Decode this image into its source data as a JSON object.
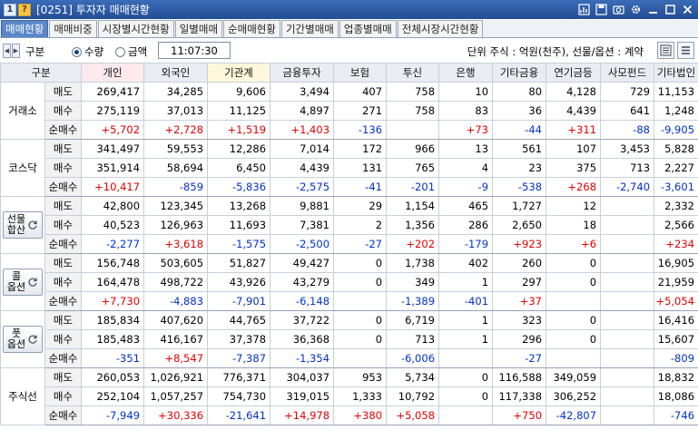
{
  "titlebar": {
    "badge": "1",
    "help": "?",
    "title": "[0251] 투자자 매매현황",
    "icons": [
      "chart-icon",
      "save-icon",
      "camera-icon",
      "gear-icon",
      "minimize-icon",
      "maximize-icon",
      "close-icon"
    ]
  },
  "tabs": [
    {
      "label": "매매현황",
      "active": true
    },
    {
      "label": "매매비중"
    },
    {
      "label": "시장별시간현황"
    },
    {
      "label": "일별매매"
    },
    {
      "label": "순매매현황"
    },
    {
      "label": "기간별매매"
    },
    {
      "label": "업종별매매"
    },
    {
      "label": "전체시장시간현황"
    }
  ],
  "controls": {
    "label": "구분",
    "radio_qty": "수량",
    "radio_amount": "금액",
    "time": "11:07:30",
    "unit": "단위 주식 : 억원(천주), 선물/옵션 : 계약"
  },
  "colors": {
    "positive": "#e00000",
    "negative": "#0032c8",
    "accent": "#2a56a0"
  },
  "headers": [
    "구분",
    "개인",
    "외국인",
    "기관계",
    "금융투자",
    "보험",
    "투신",
    "은행",
    "기타금융",
    "연기금등",
    "사모펀드",
    "기타법인"
  ],
  "groups": [
    {
      "name": "거래소",
      "button": false,
      "rows": [
        {
          "type": "매도",
          "values": [
            "269,417",
            "34,285",
            "9,606",
            "3,494",
            "407",
            "758",
            "10",
            "80",
            "4,128",
            "729",
            "11,153"
          ]
        },
        {
          "type": "매수",
          "values": [
            "275,119",
            "37,013",
            "11,125",
            "4,897",
            "271",
            "758",
            "83",
            "36",
            "4,439",
            "641",
            "1,248"
          ]
        },
        {
          "type": "순매수",
          "values": [
            "+5,702",
            "+2,728",
            "+1,519",
            "+1,403",
            "-136",
            "",
            "+73",
            "-44",
            "+311",
            "-88",
            "-9,905"
          ]
        }
      ]
    },
    {
      "name": "코스닥",
      "button": false,
      "rows": [
        {
          "type": "매도",
          "values": [
            "341,497",
            "59,553",
            "12,286",
            "7,014",
            "172",
            "966",
            "13",
            "561",
            "107",
            "3,453",
            "5,828"
          ]
        },
        {
          "type": "매수",
          "values": [
            "351,914",
            "58,694",
            "6,450",
            "4,439",
            "131",
            "765",
            "4",
            "23",
            "375",
            "713",
            "2,227"
          ]
        },
        {
          "type": "순매수",
          "values": [
            "+10,417",
            "-859",
            "-5,836",
            "-2,575",
            "-41",
            "-201",
            "-9",
            "-538",
            "+268",
            "-2,740",
            "-3,601"
          ]
        }
      ]
    },
    {
      "name": "선물",
      "name2": "합산",
      "button": true,
      "rows": [
        {
          "type": "매도",
          "values": [
            "42,800",
            "123,345",
            "13,268",
            "9,881",
            "29",
            "1,154",
            "465",
            "1,727",
            "12",
            "",
            "2,332"
          ]
        },
        {
          "type": "매수",
          "values": [
            "40,523",
            "126,963",
            "11,693",
            "7,381",
            "2",
            "1,356",
            "286",
            "2,650",
            "18",
            "",
            "2,566"
          ]
        },
        {
          "type": "순매수",
          "values": [
            "-2,277",
            "+3,618",
            "-1,575",
            "-2,500",
            "-27",
            "+202",
            "-179",
            "+923",
            "+6",
            "",
            "+234"
          ]
        }
      ]
    },
    {
      "name": "콜",
      "name2": "옵션",
      "button": true,
      "rows": [
        {
          "type": "매도",
          "values": [
            "156,748",
            "503,605",
            "51,827",
            "49,427",
            "0",
            "1,738",
            "402",
            "260",
            "0",
            "",
            "16,905"
          ]
        },
        {
          "type": "매수",
          "values": [
            "164,478",
            "498,722",
            "43,926",
            "43,279",
            "0",
            "349",
            "1",
            "297",
            "0",
            "",
            "21,959"
          ]
        },
        {
          "type": "순매수",
          "values": [
            "+7,730",
            "-4,883",
            "-7,901",
            "-6,148",
            "",
            "-1,389",
            "-401",
            "+37",
            "",
            "",
            "+5,054"
          ]
        }
      ]
    },
    {
      "name": "풋",
      "name2": "옵션",
      "button": true,
      "rows": [
        {
          "type": "매도",
          "values": [
            "185,834",
            "407,620",
            "44,765",
            "37,722",
            "0",
            "6,719",
            "1",
            "323",
            "0",
            "",
            "16,416"
          ]
        },
        {
          "type": "매수",
          "values": [
            "185,483",
            "416,167",
            "37,378",
            "36,368",
            "0",
            "713",
            "1",
            "296",
            "0",
            "",
            "15,607"
          ]
        },
        {
          "type": "순매수",
          "values": [
            "-351",
            "+8,547",
            "-7,387",
            "-1,354",
            "",
            "-6,006",
            "",
            "-27",
            "",
            "",
            "-809"
          ]
        }
      ]
    },
    {
      "name": "주식선",
      "button": false,
      "rows": [
        {
          "type": "매도",
          "values": [
            "260,053",
            "1,026,921",
            "776,371",
            "304,037",
            "953",
            "5,734",
            "0",
            "116,588",
            "349,059",
            "",
            "18,832"
          ]
        },
        {
          "type": "매수",
          "values": [
            "252,104",
            "1,057,257",
            "754,730",
            "319,015",
            "1,333",
            "10,792",
            "0",
            "117,338",
            "306,252",
            "",
            "18,086"
          ]
        },
        {
          "type": "순매수",
          "values": [
            "-7,949",
            "+30,336",
            "-21,641",
            "+14,978",
            "+380",
            "+5,058",
            "",
            "+750",
            "-42,807",
            "",
            "-746"
          ]
        }
      ]
    }
  ]
}
